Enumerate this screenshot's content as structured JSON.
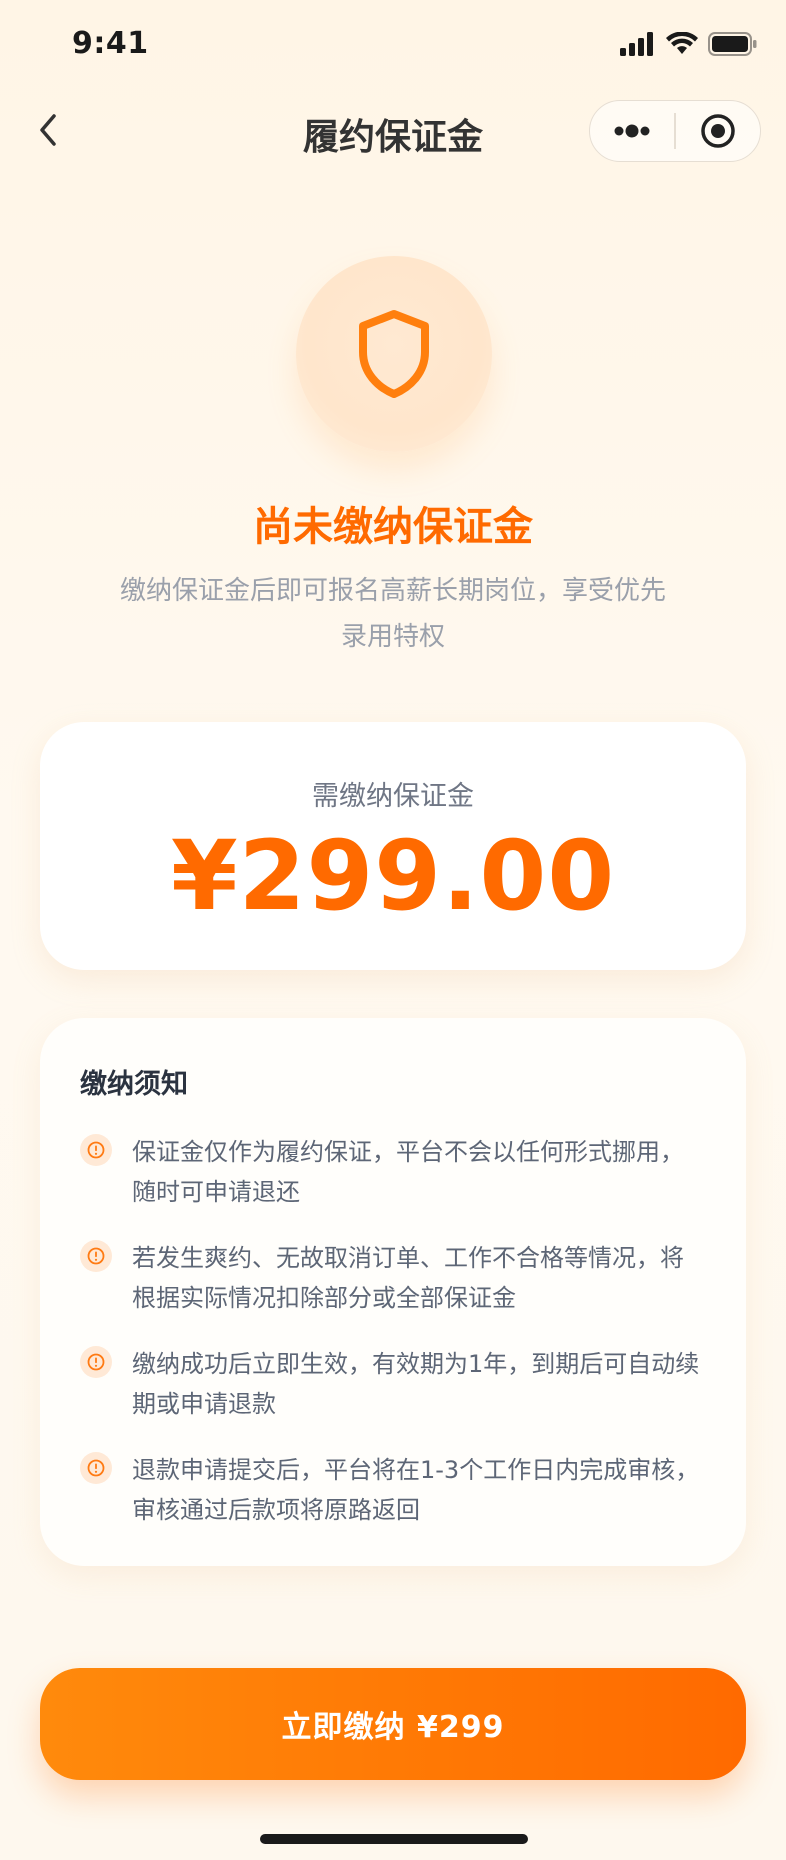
{
  "status_bar": {
    "time": "9:41"
  },
  "nav": {
    "title": "履约保证金"
  },
  "hero": {
    "title": "尚未缴纳保证金",
    "subtitle_line1": "缴纳保证金后即可报名高薪长期岗位，享受优先",
    "subtitle_line2": "录用特权"
  },
  "amount": {
    "label": "需缴纳保证金",
    "value": "¥299.00"
  },
  "notice": {
    "title": "缴纳须知",
    "items": [
      {
        "line1": "保证金仅作为履约保证，平台不会以任何形式挪用，",
        "line2": "随时可申请退还"
      },
      {
        "line1": "若发生爽约、无故取消订单、工作不合格等情况，将",
        "line2": "根据实际情况扣除部分或全部保证金"
      },
      {
        "line1": "缴纳成功后立即生效，有效期为1年，到期后可自动续",
        "line2": "期或申请退款"
      },
      {
        "line1": "退款申请提交后，平台将在1-3个工作日内完成审核，",
        "line2": "审核通过后款项将原路返回"
      }
    ]
  },
  "pay_button": {
    "label": "立即缴纳 ¥299"
  },
  "colors": {
    "accent": "#FF6A00",
    "icon_bg": "#FFE9D6"
  },
  "icons": {
    "back": "chevron-left-icon",
    "more": "more-dots-icon",
    "close": "target-circle-icon",
    "shield": "shield-icon",
    "notice": "alert-circle-icon"
  }
}
